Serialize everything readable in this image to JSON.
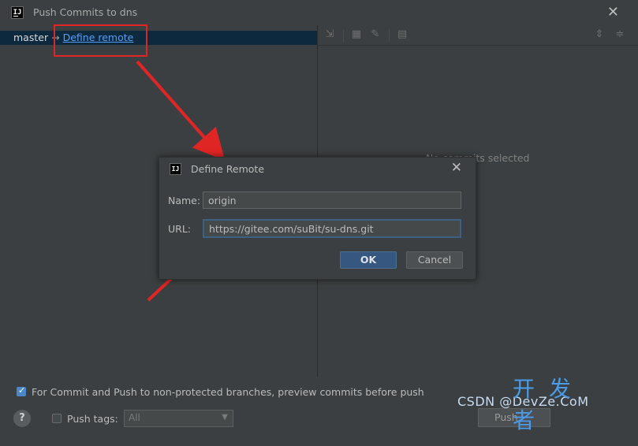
{
  "window": {
    "title": "Push Commits to dns"
  },
  "branch": {
    "name": "master",
    "arrow": "→",
    "link": "Define remote"
  },
  "right_pane": {
    "empty_text": "No commits selected"
  },
  "dialog": {
    "title": "Define Remote",
    "name_label": "Name:",
    "name_value": "origin",
    "url_label": "URL:",
    "url_value": "https://gitee.com/suBit/su-dns.git",
    "ok_label": "OK",
    "cancel_label": "Cancel"
  },
  "bottom": {
    "preview_label": "For Commit and Push to non-protected branches, preview commits before push",
    "preview_checked": true,
    "help_label": "?",
    "push_tags_label": "Push tags:",
    "push_tags_value": "All",
    "push_button": "Push"
  },
  "watermark": {
    "big": "开发者",
    "small": "CSDN @DevZe.CoM"
  },
  "colors": {
    "annotation": "#e02525",
    "link": "#589df6",
    "accent": "#365880"
  }
}
